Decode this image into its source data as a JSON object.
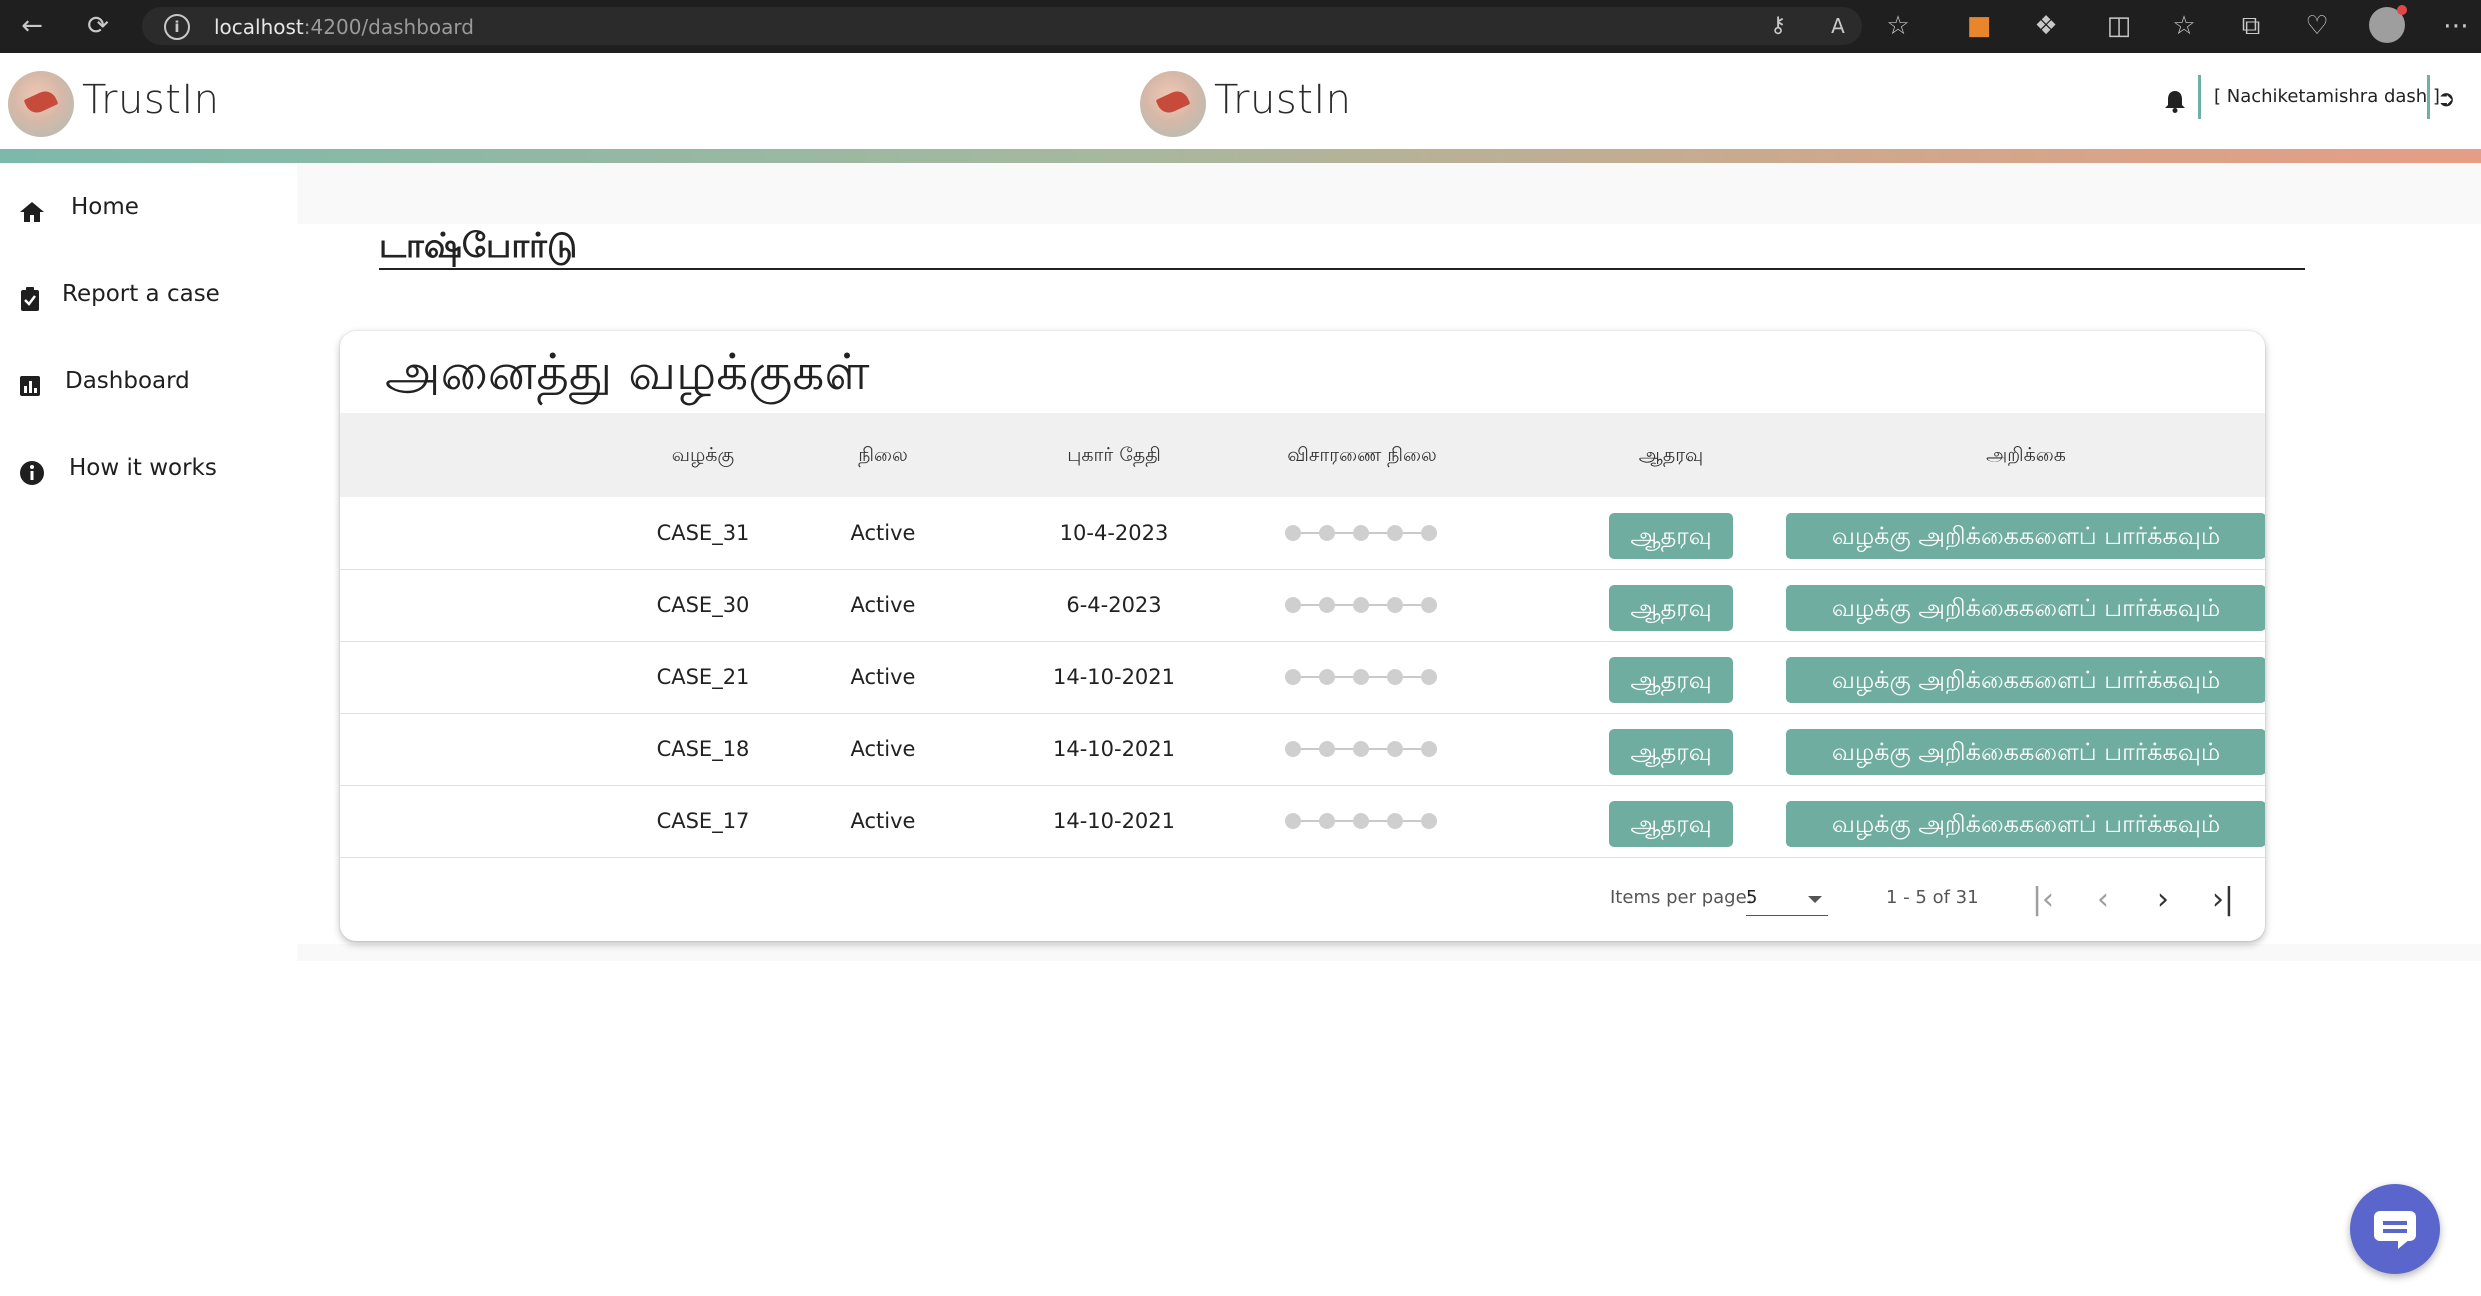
{
  "browser": {
    "url_host": "localhost",
    "url_path": ":4200/dashboard"
  },
  "header": {
    "brand_left": "TrustIn",
    "brand_center": "TrustIn",
    "user": "[ Nachiketamishra dash ]"
  },
  "sidebar": {
    "items": [
      {
        "label": "Home",
        "icon": "home-icon"
      },
      {
        "label": "Report a case",
        "icon": "clipboard-check-icon"
      },
      {
        "label": "Dashboard",
        "icon": "bar-chart-icon"
      },
      {
        "label": "How it works",
        "icon": "info-icon"
      }
    ]
  },
  "page": {
    "title": "டாஷ்போர்டு"
  },
  "cases": {
    "title": "அனைத்து வழக்குகள்",
    "columns": [
      "வழக்கு",
      "நிலை",
      "புகார் தேதி",
      "விசாரணை நிலை",
      "ஆதரவு",
      "அறிக்கை"
    ],
    "rows": [
      {
        "case": "CASE_31",
        "status": "Active",
        "date": "10-4-2023",
        "support": "ஆதரவு",
        "report": "வழக்கு அறிக்கைகளைப் பார்க்கவும்"
      },
      {
        "case": "CASE_30",
        "status": "Active",
        "date": "6-4-2023",
        "support": "ஆதரவு",
        "report": "வழக்கு அறிக்கைகளைப் பார்க்கவும்"
      },
      {
        "case": "CASE_21",
        "status": "Active",
        "date": "14-10-2021",
        "support": "ஆதரவு",
        "report": "வழக்கு அறிக்கைகளைப் பார்க்கவும்"
      },
      {
        "case": "CASE_18",
        "status": "Active",
        "date": "14-10-2021",
        "support": "ஆதரவு",
        "report": "வழக்கு அறிக்கைகளைப் பார்க்கவும்"
      },
      {
        "case": "CASE_17",
        "status": "Active",
        "date": "14-10-2021",
        "support": "ஆதரவு",
        "report": "வழக்கு அறிக்கைகளைப் பார்க்கவும்"
      }
    ],
    "paginator": {
      "items_per_page_label": "Items per page:",
      "items_per_page_value": "5",
      "range_label": "1 - 5 of 31"
    }
  },
  "colors": {
    "accent": "#6fada0",
    "chat": "#5a66cc"
  }
}
